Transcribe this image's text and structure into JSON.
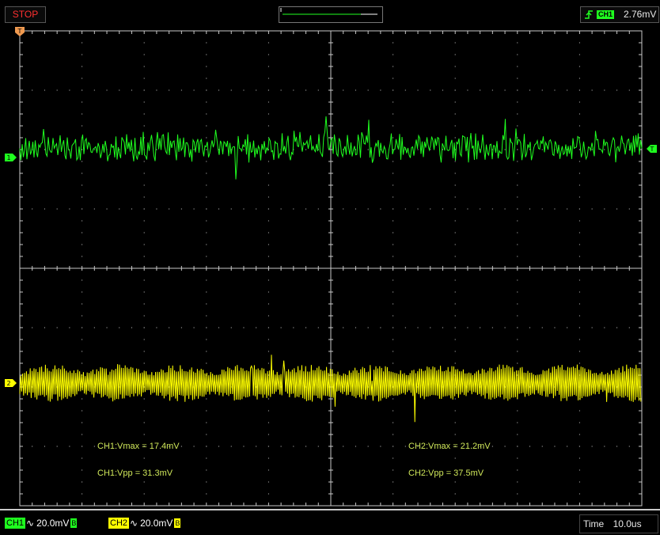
{
  "status": {
    "run_state": "STOP"
  },
  "trigger": {
    "channel": "CH1",
    "level": "2.76mV"
  },
  "markers": {
    "trigger_position": "T",
    "ch1_marker": "1",
    "ch2_marker": "2",
    "trigger_level_marker": "T"
  },
  "measurements": {
    "ch1_vmax": "CH1:Vmax = 17.4mV",
    "ch1_vpp": "CH1:Vpp = 31.3mV",
    "ch2_vmax": "CH2:Vmax = 21.2mV",
    "ch2_vpp": "CH2:Vpp = 37.5mV"
  },
  "channels": [
    {
      "name": "CH1",
      "coupling": "∿",
      "scale": "20.0mV",
      "bw": "B",
      "color": "#1fff1f"
    },
    {
      "name": "CH2",
      "coupling": "∿",
      "scale": "20.0mV",
      "bw": "B",
      "color": "#ffff00"
    }
  ],
  "timebase": {
    "label": "Time",
    "value": "10.0us"
  },
  "icons": {
    "trigger_edge": "rising-edge-icon",
    "overview": "waveform-overview-icon"
  },
  "colors": {
    "ch1": "#1fff1f",
    "ch2": "#ffff00",
    "grid": "#c8c8c8",
    "run_state": "#ff3030",
    "measurement_text": "#d0e85a"
  }
}
